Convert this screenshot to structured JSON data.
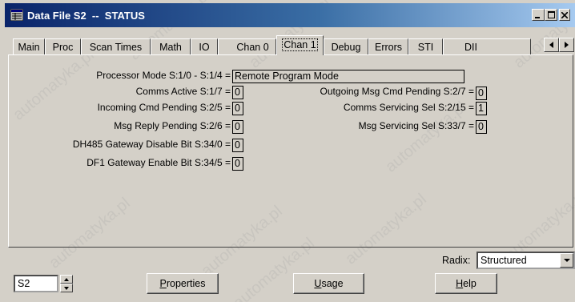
{
  "window": {
    "title": "Data File S2  --  STATUS",
    "controls": [
      "minimize",
      "maximize",
      "close"
    ]
  },
  "tabs": [
    {
      "label": "Main",
      "active": false
    },
    {
      "label": "Proc",
      "active": false
    },
    {
      "label": "Scan Times",
      "active": false
    },
    {
      "label": "Math",
      "active": false
    },
    {
      "label": "IO",
      "active": false
    },
    {
      "label": "Chan 0",
      "active": false
    },
    {
      "label": "Chan 1",
      "active": true
    },
    {
      "label": "Debug",
      "active": false
    },
    {
      "label": "Errors",
      "active": false
    },
    {
      "label": "STI",
      "active": false
    },
    {
      "label": "DII",
      "active": false
    }
  ],
  "fields": {
    "processor_mode": {
      "label": "Processor Mode S:1/0 - S:1/4 =",
      "value": "Remote Program Mode"
    },
    "comms_active": {
      "label": "Comms Active S:1/7 =",
      "value": "0"
    },
    "incoming_cmd_pending": {
      "label": "Incoming Cmd Pending S:2/5 =",
      "value": "0"
    },
    "msg_reply_pending": {
      "label": "Msg Reply Pending S:2/6 =",
      "value": "0"
    },
    "dh485_gateway_disable": {
      "label": "DH485 Gateway Disable Bit S:34/0 =",
      "value": "0"
    },
    "df1_gateway_enable": {
      "label": "DF1 Gateway Enable Bit S:34/5 =",
      "value": "0"
    },
    "outgoing_msg_cmd_pending": {
      "label": "Outgoing Msg Cmd Pending S:2/7 =",
      "value": "0"
    },
    "comms_servicing_sel": {
      "label": "Comms Servicing Sel S:2/15 =",
      "value": "1"
    },
    "msg_servicing_sel": {
      "label": "Msg Servicing Sel S:33/7 =",
      "value": "0"
    }
  },
  "radix": {
    "label": "Radix:",
    "value": "Structured"
  },
  "file_selector": {
    "value": "S2"
  },
  "buttons": {
    "properties": {
      "pre": "",
      "hot": "P",
      "post": "roperties"
    },
    "usage": {
      "pre": "",
      "hot": "U",
      "post": "sage"
    },
    "help": {
      "pre": "",
      "hot": "H",
      "post": "elp"
    }
  },
  "watermark": "automatyka.pl"
}
